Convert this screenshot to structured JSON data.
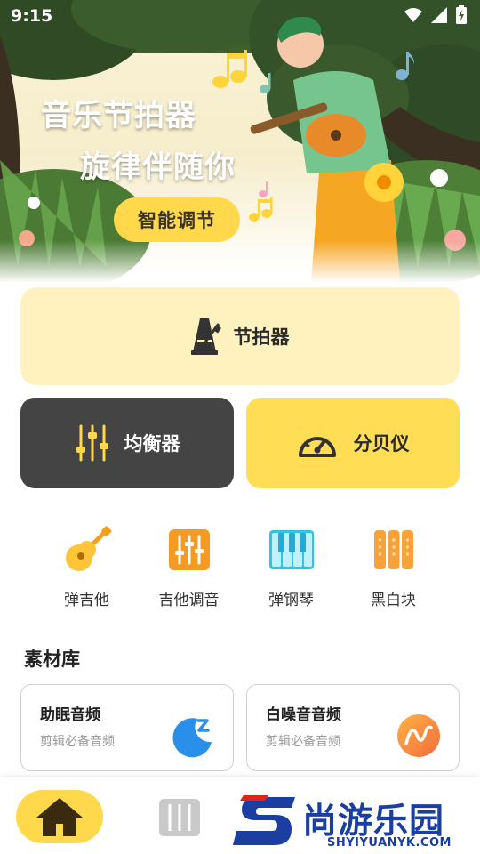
{
  "status_bar": {
    "time": "9:15"
  },
  "hero": {
    "title_line1": "音乐节拍器",
    "title_line2": "旋律伴随你",
    "action_label": "智能调节"
  },
  "cards": {
    "metronome": {
      "label": "节拍器",
      "icon": "metronome-icon"
    },
    "equalizer": {
      "label": "均衡器",
      "icon": "equalizer-sliders-icon"
    },
    "decibel": {
      "label": "分贝仪",
      "icon": "gauge-icon"
    }
  },
  "tools": [
    {
      "label": "弹吉他",
      "icon": "guitar-icon"
    },
    {
      "label": "吉他调音",
      "icon": "tuner-icon"
    },
    {
      "label": "弹钢琴",
      "icon": "piano-keys-icon"
    },
    {
      "label": "黑白块",
      "icon": "tiles-icon"
    }
  ],
  "library": {
    "title": "素材库",
    "items": [
      {
        "name": "助眠音频",
        "subtitle": "剪辑必备音频",
        "icon": "moon-sleep-icon"
      },
      {
        "name": "白噪音音频",
        "subtitle": "剪辑必备音频",
        "icon": "wave-icon"
      }
    ]
  },
  "bottom_nav": {
    "items": [
      {
        "icon": "home-icon",
        "active": true
      },
      {
        "icon": "tools-icon",
        "active": false
      }
    ]
  },
  "watermark": {
    "text_cn": "尚游乐园",
    "text_en": "SHYIYUANYK.COM"
  },
  "colors": {
    "accent_yellow": "#ffd84c",
    "light_yellow": "#fff2bf",
    "dark_card": "#444444",
    "watermark_blue": "#1b3fa0"
  }
}
